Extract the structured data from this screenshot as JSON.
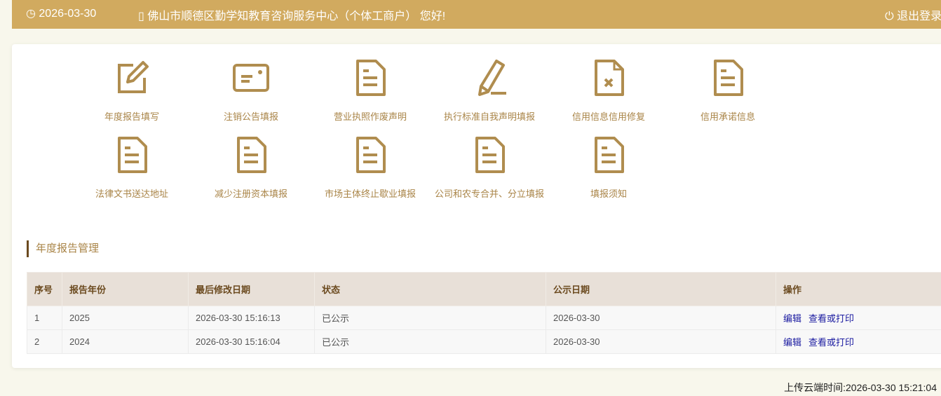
{
  "header": {
    "date": "2026-03-30",
    "greeting": "佛山市顺德区勤学知教育咨询服务中心（个体工商户） 您好!",
    "logout": "退出登录"
  },
  "tiles": [
    {
      "label": "年度报告填写",
      "icon": "edit-icon"
    },
    {
      "label": "注销公告填报",
      "icon": "card-icon"
    },
    {
      "label": "营业执照作废声明",
      "icon": "document-icon"
    },
    {
      "label": "执行标准自我声明填报",
      "icon": "pencil-icon"
    },
    {
      "label": "信用信息信用修复",
      "icon": "document-x-icon"
    },
    {
      "label": "信用承诺信息",
      "icon": "document-icon"
    },
    {
      "label": "法律文书送达地址",
      "icon": "document-icon"
    },
    {
      "label": "减少注册资本填报",
      "icon": "document-icon"
    },
    {
      "label": "市场主体终止歇业填报",
      "icon": "document-icon"
    },
    {
      "label": "公司和农专合并、分立填报",
      "icon": "document-icon"
    },
    {
      "label": "填报须知",
      "icon": "document-icon"
    }
  ],
  "section_title": "年度报告管理",
  "table": {
    "headers": [
      "序号",
      "报告年份",
      "最后修改日期",
      "状态",
      "公示日期",
      "操作"
    ],
    "rows": [
      {
        "no": "1",
        "year": "2025",
        "modified": "2026-03-30 15:16:13",
        "status": "已公示",
        "published": "2026-03-30",
        "edit": "编辑",
        "view": "查看或打印"
      },
      {
        "no": "2",
        "year": "2024",
        "modified": "2026-03-30 15:16:04",
        "status": "已公示",
        "published": "2026-03-30",
        "edit": "编辑",
        "view": "查看或打印"
      }
    ]
  },
  "footer": {
    "upload_time": "上传云端时间:2026-03-30 15:21:04"
  },
  "colors": {
    "accent": "#d1aa5f",
    "icon": "#b08d4f"
  }
}
